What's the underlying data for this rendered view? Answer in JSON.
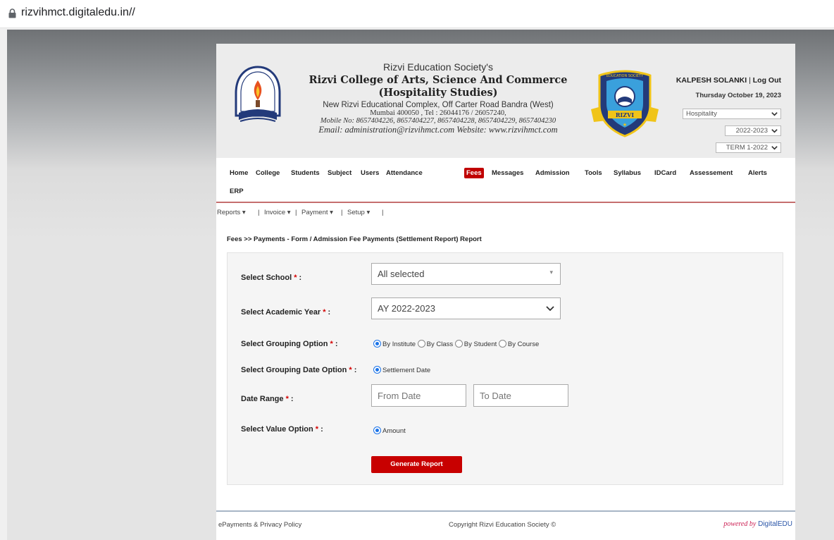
{
  "browser": {
    "url": "rizvihmct.digitaledu.in//"
  },
  "header": {
    "society": "Rizvi Education Society's",
    "college_name": "Rizvi College of Arts, Science And Commerce",
    "college_sub": "(Hospitality Studies)",
    "address": "New Rizvi Educational Complex, Off Carter Road Bandra (West)",
    "city_tel": "Mumbai 400050 , Tel : 26044176 / 26057240,",
    "mobile": "Mobile No: 8657404226, 8657404227, 8657404228, 8657404229, 8657404230",
    "email_web": "Email: administration@rizvihmct.com Website: www.rizvihmct.com",
    "badge_top": "EDUCATION SOCIETY",
    "badge_text": "RIZVI",
    "user": "KALPESH SOLANKI",
    "logout": "Log Out",
    "date": "Thursday October 19, 2023",
    "stream_select": "Hospitality",
    "year_select": "2022-2023",
    "term_select": "TERM 1-2022"
  },
  "nav": {
    "items": [
      "Home",
      "College",
      "Students",
      "Subject",
      "Users",
      "Attendance",
      "Fees",
      "Messages",
      "Admission",
      "Tools",
      "Syllabus",
      "IDCard",
      "Assessement",
      "Alerts",
      "ERP"
    ],
    "active": "Fees"
  },
  "subnav": [
    "Reports",
    "Invoice",
    "Payment",
    "Setup"
  ],
  "breadcrumb": "Fees >> Payments - Form / Admission Fee Payments (Settlement Report) Report",
  "form": {
    "school_label": "Select School",
    "school_value": "All selected",
    "year_label": "Select Academic Year",
    "year_value": "AY 2022-2023",
    "grouping_label": "Select Grouping Option",
    "grouping_options": [
      "By Institute",
      "By Class",
      "By Student",
      "By Course"
    ],
    "grouping_date_label": "Select Grouping Date Option",
    "grouping_date_option": "Settlement Date",
    "date_range_label": "Date Range",
    "from_placeholder": "From Date",
    "to_placeholder": "To Date",
    "value_label": "Select Value Option",
    "value_option": "Amount",
    "generate": "Generate Report"
  },
  "footer": {
    "left": "ePayments & Privacy Policy",
    "center": "Copyright Rizvi Education Society ©",
    "powered": "powered by",
    "brand": "DigitalEDU"
  },
  "colors": {
    "accent": "#c80000",
    "radio": "#1a73e8"
  }
}
